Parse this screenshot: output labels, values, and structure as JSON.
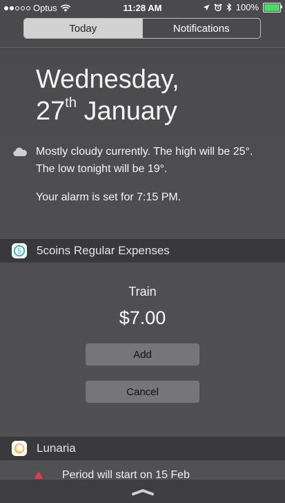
{
  "status_bar": {
    "carrier": "Optus",
    "time": "11:28 AM",
    "battery": "100%",
    "signal_bars_filled": 2,
    "signal_bars_total": 5
  },
  "segmented": {
    "today_label": "Today",
    "notifications_label": "Notifications"
  },
  "date": {
    "weekday": "Wednesday,",
    "day": "27",
    "ordinal": "th",
    "month": "January"
  },
  "weather": {
    "summary": "Mostly cloudy currently. The high will be 25°. The low tonight will be 19°."
  },
  "alarm": {
    "text": "Your alarm is set for 7:15 PM."
  },
  "coins_widget": {
    "title": "5coins Regular Expenses",
    "expense_name": "Train",
    "expense_amount": "$7.00",
    "add_label": "Add",
    "cancel_label": "Cancel"
  },
  "lunaria_widget": {
    "title": "Lunaria",
    "period_text": "Period will start on 15 Feb"
  },
  "colors": {
    "battery": "#4cd964",
    "coins_accent": "#2bb5c7",
    "lunaria_accent": "#f2b33d",
    "drop": "#e53b4e"
  }
}
